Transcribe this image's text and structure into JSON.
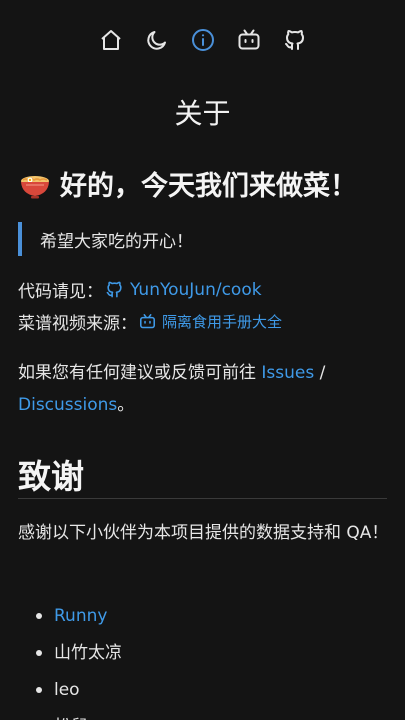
{
  "nav": {
    "items": [
      {
        "icon": "home-icon"
      },
      {
        "icon": "moon-icon"
      },
      {
        "icon": "info-icon",
        "active": true
      },
      {
        "icon": "bilibili-icon"
      },
      {
        "icon": "github-icon"
      }
    ],
    "active_color": "#4a90d9"
  },
  "page_title": "关于",
  "headline": {
    "emoji": "bowl-icon",
    "text": "好的，今天我们来做菜！"
  },
  "quote": "希望大家吃的开心！",
  "code_line": {
    "label": "代码请见：",
    "link_text": "YunYouJun/cook",
    "icon": "github-icon"
  },
  "video_line": {
    "label": "菜谱视频来源：",
    "link_text": "隔离食用手册大全",
    "icon": "bilibili-icon"
  },
  "feedback": {
    "prefix": "如果您有任何建议或反馈可前往 ",
    "issues": "Issues",
    "separator": " / ",
    "discussions": "Discussions",
    "suffix": "。"
  },
  "thanks_heading": "致谢",
  "thanks_text": "感谢以下小伙伴为本项目提供的数据支持和 QA！",
  "contributors": [
    {
      "name": "Runny",
      "link": true
    },
    {
      "name": "山竹太凉",
      "link": false
    },
    {
      "name": "leo",
      "link": false
    },
    {
      "name": "松鼠",
      "link": false
    }
  ],
  "colors": {
    "background": "#141414",
    "link": "#3f9ae8",
    "accent": "#4a90d9"
  }
}
